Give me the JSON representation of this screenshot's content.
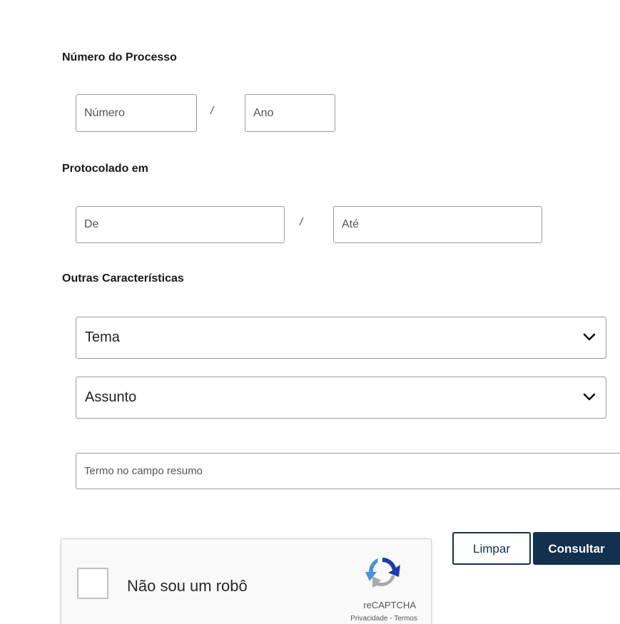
{
  "numero_processo": {
    "label": "Número do Processo",
    "numero_placeholder": "Número",
    "separator": "/",
    "ano_placeholder": "Ano"
  },
  "protocolado": {
    "label": "Protocolado em",
    "de_placeholder": "De",
    "separator": "/",
    "ate_placeholder": "Até"
  },
  "outras": {
    "label": "Outras Características",
    "tema_selected": "Tema",
    "assunto_selected": "Assunto",
    "termo_placeholder": "Termo no campo resumo"
  },
  "captcha": {
    "label": "Não sou um robô",
    "brand": "reCAPTCHA",
    "privacy": "Privacidade",
    "links_separator": " - ",
    "terms": "Termos"
  },
  "actions": {
    "limpar_label": "Limpar",
    "consultar_label": "Consultar"
  },
  "colors": {
    "primary": "#13304f",
    "border": "#9a9a9a",
    "captcha_blue": "#1c3aa9",
    "captcha_light_blue": "#4a90e2"
  },
  "icons": {
    "select_arrow": "chevron-down-icon",
    "captcha_logo": "recaptcha-logo-icon"
  }
}
